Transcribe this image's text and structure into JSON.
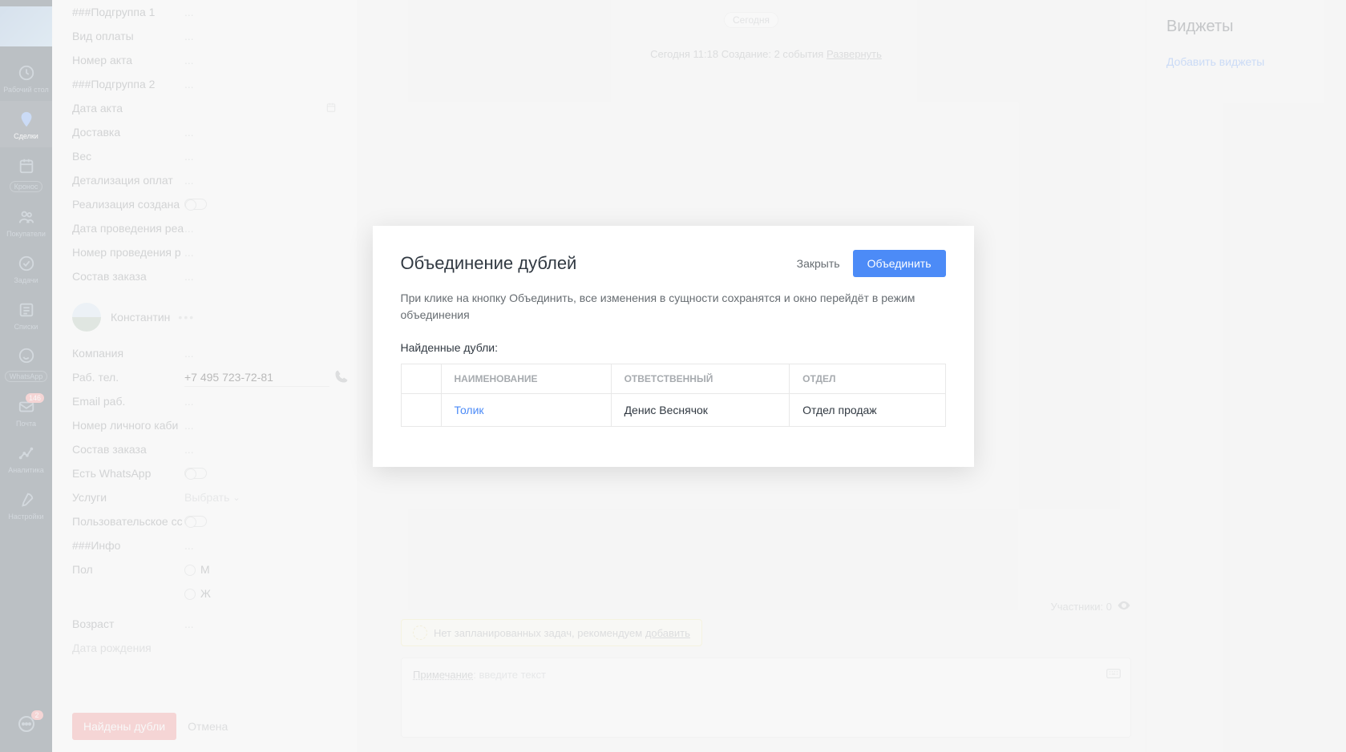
{
  "nav": {
    "items": [
      {
        "label": "Рабочий стол",
        "icon": "dashboard-icon",
        "badge": ""
      },
      {
        "label": "Сделки",
        "icon": "deals-icon",
        "badge": "",
        "active": true
      },
      {
        "label": "Кронос",
        "icon": "kronos-icon",
        "pill": "Кронос"
      },
      {
        "label": "Покупатели",
        "icon": "buyers-icon",
        "badge": ""
      },
      {
        "label": "Задачи",
        "icon": "tasks-icon",
        "badge": ""
      },
      {
        "label": "Списки",
        "icon": "lists-icon",
        "badge": ""
      },
      {
        "label": "WhatsApp",
        "icon": "whatsapp-icon",
        "pill": "WhatsApp"
      },
      {
        "label": "Почта",
        "icon": "mail-icon",
        "badge": "146"
      },
      {
        "label": "Аналитика",
        "icon": "analytics-icon",
        "badge": ""
      },
      {
        "label": "Настройки",
        "icon": "settings-icon",
        "badge": ""
      }
    ],
    "bottom_badge": "2"
  },
  "details": {
    "fields_top": [
      {
        "label": "###Подгруппа 1",
        "value": "..."
      },
      {
        "label": "Вид оплаты",
        "value": "..."
      },
      {
        "label": "Номер акта",
        "value": "..."
      },
      {
        "label": "###Подгруппа 2",
        "value": "..."
      },
      {
        "label": "Дата акта",
        "value": "",
        "type": "date"
      },
      {
        "label": "Доставка",
        "value": "..."
      },
      {
        "label": "Вес",
        "value": "..."
      },
      {
        "label": "Детализация оплат",
        "value": "..."
      },
      {
        "label": "Реализация создана",
        "value": "",
        "type": "toggle"
      },
      {
        "label": "Дата проведения реа",
        "value": "..."
      },
      {
        "label": "Номер проведения р",
        "value": "..."
      },
      {
        "label": "Состав заказа",
        "value": "..."
      }
    ],
    "contact_name": "Константин",
    "fields_contact": [
      {
        "label": "Компания",
        "value": "..."
      },
      {
        "label": "Раб. тел.",
        "value": "+7 495 723-72-81",
        "type": "phone"
      },
      {
        "label": "Email раб.",
        "value": "..."
      },
      {
        "label": "Номер личного каби",
        "value": "..."
      },
      {
        "label": "Состав заказа",
        "value": "..."
      },
      {
        "label": "Есть WhatsApp",
        "value": "",
        "type": "toggle"
      },
      {
        "label": "Услуги",
        "value": "Выбрать",
        "type": "select"
      },
      {
        "label": "Пользовательское сс",
        "value": "",
        "type": "toggle"
      },
      {
        "label": "###Инфо",
        "value": "..."
      }
    ],
    "gender_label": "Пол",
    "gender_m": "М",
    "gender_f": "Ж",
    "age_label": "Возраст",
    "age_value": "...",
    "birth_label": "Дата рождения",
    "btn_dups": "Найдены дубли",
    "btn_cancel": "Отмена"
  },
  "timeline": {
    "today": "Сегодня",
    "entry_prefix": "Сегодня 11:18 Создание: 2 события ",
    "expand": "Развернуть",
    "no_tasks": "Нет запланированных задач, рекомендуем ",
    "add": "добавить",
    "participants": "Участники: 0",
    "note_label": "Примечание",
    "note_placeholder": ": введите текст"
  },
  "widgets": {
    "title": "Виджеты",
    "add": "Добавить виджеты"
  },
  "modal": {
    "title": "Объединение дублей",
    "close": "Закрыть",
    "merge": "Объединить",
    "desc": "При клике на кнопку Объединить, все изменения в сущности сохранятся и окно перейдёт в режим объединения",
    "found": "Найденные дубли:",
    "headers": [
      "",
      "НАИМЕНОВАНИЕ",
      "ОТВЕТСТВЕННЫЙ",
      "ОТДЕЛ"
    ],
    "row": {
      "name": "Толик",
      "owner": "Денис Веснячок",
      "dept": "Отдел продаж"
    }
  }
}
